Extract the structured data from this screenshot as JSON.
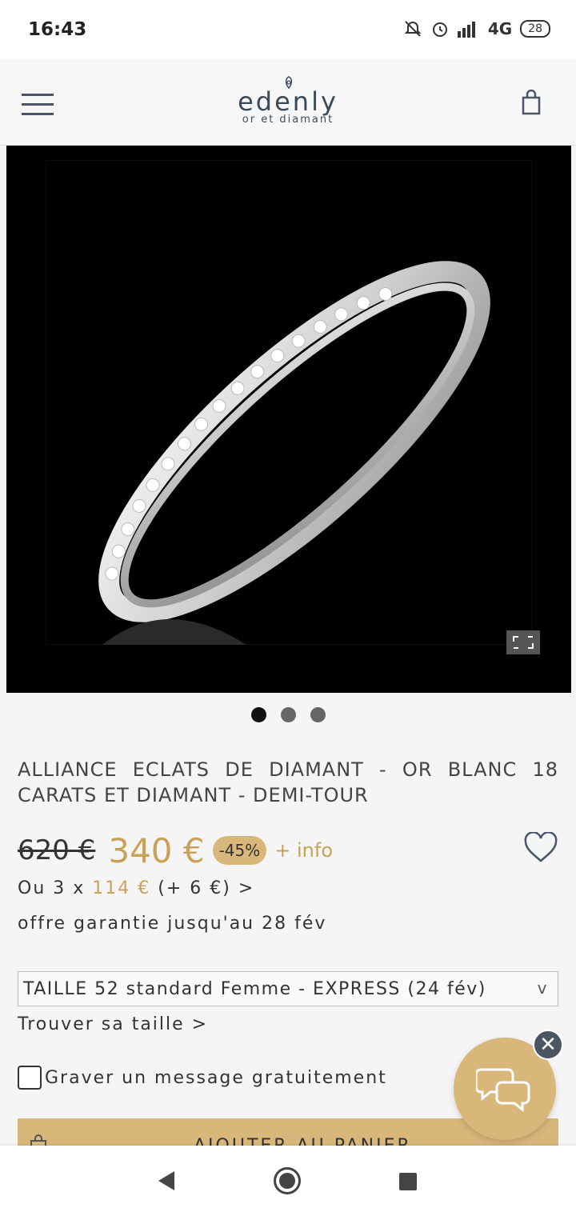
{
  "status_bar": {
    "time": "16:43",
    "network": "4G",
    "battery": "28",
    "icons": [
      "mute-icon",
      "alarm-icon",
      "signal-icon",
      "battery-icon"
    ]
  },
  "header": {
    "brand": "edenly",
    "tagline": "or et diamant",
    "icons": [
      "menu-icon",
      "logo-mark",
      "shopping-bag-icon"
    ]
  },
  "gallery": {
    "total_images": 3,
    "active_index": 0,
    "icons": [
      "expand-icon"
    ]
  },
  "product": {
    "title": "ALLIANCE ECLATS DE DIAMANT - OR BLANC 18 CARATS ET DIAMANT - DEMI-TOUR",
    "old_price": "620 €",
    "new_price": "340 €",
    "discount": "-45%",
    "info_link": "+ info",
    "installment_prefix": "Ou 3 x ",
    "installment_amount": "114 €",
    "installment_suffix": " (+ 6 €) >",
    "offer": "offre garantie jusqu'au 28 fév",
    "size_selected": "TAILLE 52 standard Femme - EXPRESS (24 fév)",
    "size_chevron": "v",
    "find_size": "Trouver sa taille >",
    "engrave_label": "Graver un message gratuitement",
    "engrave_checked": false,
    "add_to_cart": "AJOUTER AU PANIER"
  },
  "chat": {
    "close": "✕"
  },
  "colors": {
    "gold": "#c9a25a",
    "gold_bg": "#d9b77a",
    "dark_text": "#333333",
    "brand_blue": "#3b4a5a"
  }
}
